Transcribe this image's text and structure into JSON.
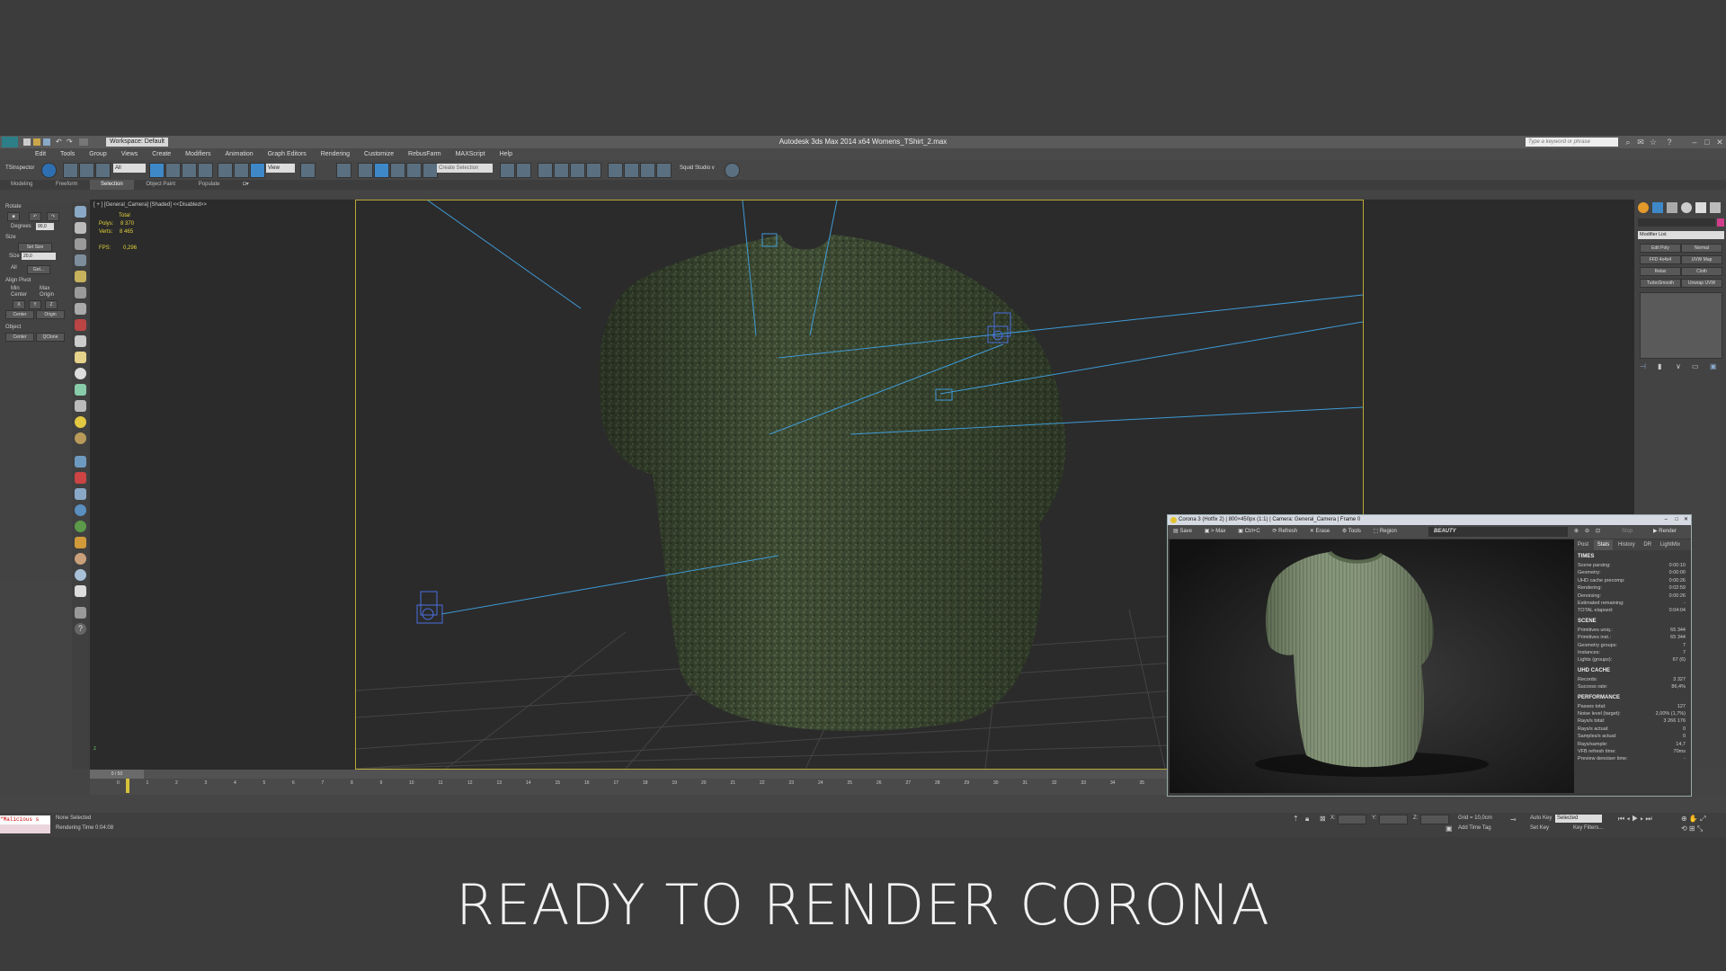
{
  "app": {
    "title": "Autodesk 3ds Max  2014 x64     Womens_TShirt_2.max",
    "workspace": "Workspace: Default",
    "search_placeholder": "Type a keyword or phrase"
  },
  "menu": [
    "Edit",
    "Tools",
    "Group",
    "Views",
    "Create",
    "Modifiers",
    "Animation",
    "Graph Editors",
    "Rendering",
    "Customize",
    "RebusFarm",
    "MAXScript",
    "Help"
  ],
  "toolbar": {
    "tsinspector": "TSInspector",
    "filter": "All",
    "view": "View",
    "selection_set": "Create Selection",
    "squid": "Squid Studio v"
  },
  "ribbon_tabs": [
    "Modeling",
    "Freeform",
    "Selection",
    "Object Paint",
    "Populate"
  ],
  "ribbon_active": "Selection",
  "left_panel": {
    "rotate": "Rotate",
    "degrees_label": "Degrees",
    "degrees_value": "90,0",
    "size": "Size",
    "set_size": "Set Size",
    "size_label": "Size",
    "size_value": "20,0",
    "all": "All",
    "get": "Get...",
    "align_pivot": "Align Pivot",
    "min": "Min",
    "max": "Max",
    "center": "Center",
    "origin": "Origin",
    "x": "X",
    "y": "Y",
    "z": "Z",
    "object": "Object",
    "qclone": "QClone"
  },
  "viewport": {
    "label": "[ + ] [General_Camera] [Shaded] <<Disabled>>",
    "stats": {
      "total": "Total",
      "polys_label": "Polys:",
      "polys": "8 370",
      "verts_label": "Verts:",
      "verts": "8 465",
      "fps_label": "FPS:",
      "fps": "0,296"
    },
    "axis": "z"
  },
  "right_panel": {
    "modifier_list": "Modifier List",
    "buttons": [
      "Edit Poly",
      "Normal",
      "FFD 4x4x4",
      "UVW Map",
      "Relax",
      "Cloth",
      "TurboSmooth",
      "Unwrap UVW"
    ]
  },
  "vfb": {
    "title": "Corona 3 (Hotfix 2) | 800×450px (1:1) | Camera: General_Camera | Frame 0",
    "toolbar": [
      "Save",
      "> Max",
      "Ctrl+C",
      "Refresh",
      "Erase",
      "Tools",
      "Region"
    ],
    "channel": "BEAUTY",
    "stop": "Stop",
    "render": "Render",
    "tabs": [
      "Post",
      "Stats",
      "History",
      "DR",
      "LightMix"
    ],
    "tabs_active": "Stats",
    "sections": [
      {
        "title": "TIMES",
        "rows": [
          {
            "k": "Scene parsing:",
            "v": "0:00:10"
          },
          {
            "k": "Geometry:",
            "v": "0:00:00"
          },
          {
            "k": "UHD cache precomp:",
            "v": "0:00:26"
          },
          {
            "k": "Rendering:",
            "v": "0:02:59"
          },
          {
            "k": "Denoising:",
            "v": "0:00:26"
          },
          {
            "k": "Estimated remaining:",
            "v": "-"
          },
          {
            "k": "TOTAL elapsed:",
            "v": "0:04:04"
          }
        ]
      },
      {
        "title": "SCENE",
        "rows": [
          {
            "k": "Primitives uniq.:",
            "v": "65 344"
          },
          {
            "k": "Primitives inst.:",
            "v": "65 344"
          },
          {
            "k": "Geometry groups:",
            "v": "7"
          },
          {
            "k": "Instances:",
            "v": "7"
          },
          {
            "k": "Lights (groups):",
            "v": "67 (6)"
          }
        ]
      },
      {
        "title": "UHD CACHE",
        "rows": [
          {
            "k": "Records:",
            "v": "3 327"
          },
          {
            "k": "Success rate:",
            "v": "86,4%"
          }
        ]
      },
      {
        "title": "PERFORMANCE",
        "rows": [
          {
            "k": "Passes total:",
            "v": "127"
          },
          {
            "k": "Noise level (target):",
            "v": "2,00% (1,7%)"
          },
          {
            "k": "Rays/s total:",
            "v": "3 266 176"
          },
          {
            "k": "Rays/s actual:",
            "v": "0"
          },
          {
            "k": "Samples/s actual:",
            "v": "0"
          },
          {
            "k": "Rays/sample:",
            "v": "14,7"
          },
          {
            "k": "VFB refresh time:",
            "v": "70ms"
          },
          {
            "k": "Preview denoiser time:",
            "v": "-"
          }
        ]
      }
    ]
  },
  "timeline": {
    "slider": "0 / 50",
    "ticks": [
      "0",
      "1",
      "2",
      "3",
      "4",
      "5",
      "6",
      "7",
      "8",
      "9",
      "10",
      "11",
      "12",
      "13",
      "14",
      "15",
      "16",
      "17",
      "18",
      "19",
      "20",
      "21",
      "22",
      "23",
      "24",
      "25",
      "26",
      "27",
      "28",
      "29",
      "30",
      "31",
      "32",
      "33",
      "34",
      "35"
    ]
  },
  "status": {
    "maxscript": "\"Malicious s",
    "selection": "None Selected",
    "render_time": "Rendering Time  0:04:08",
    "x_label": "X:",
    "y_label": "Y:",
    "z_label": "Z:",
    "grid": "Grid = 10,0cm",
    "add_time_tag": "Add Time Tag",
    "auto_key": "Auto Key",
    "set_key": "Set Key",
    "selected": "Selected",
    "key_filters": "Key Filters..."
  },
  "caption": "READY TO RENDER  CORONA",
  "colors": {
    "shirt": "#3d4a33",
    "vfb_shirt": "#7d8f6e",
    "frame": "#b9a937",
    "light_lines": "#3f9ad6"
  }
}
